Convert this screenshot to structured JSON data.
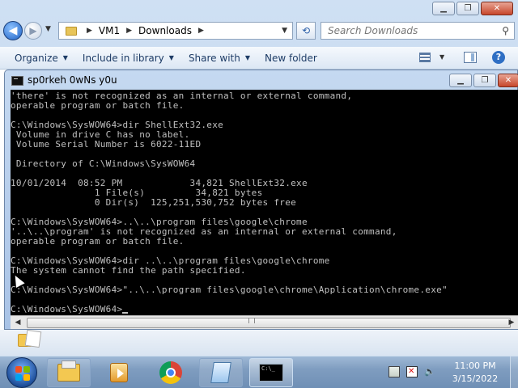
{
  "explorer": {
    "address_segments": [
      "VM1",
      "Downloads"
    ],
    "search_placeholder": "Search Downloads",
    "commands": [
      {
        "label": "Organize"
      },
      {
        "label": "Include in library"
      },
      {
        "label": "Share with"
      },
      {
        "label": "New folder"
      }
    ]
  },
  "cmd_window": {
    "title": "sp0rkeh 0wNs y0u",
    "lines": [
      "'there' is not recognized as an internal or external command,",
      "operable program or batch file.",
      "",
      "C:\\Windows\\SysWOW64>dir ShellExt32.exe",
      " Volume in drive C has no label.",
      " Volume Serial Number is 6022-11ED",
      "",
      " Directory of C:\\Windows\\SysWOW64",
      "",
      "10/01/2014  08:52 PM            34,821 ShellExt32.exe",
      "               1 File(s)         34,821 bytes",
      "               0 Dir(s)  125,251,530,752 bytes free",
      "",
      "C:\\Windows\\SysWOW64>..\\..\\program files\\google\\chrome",
      "'..\\..\\program' is not recognized as an internal or external command,",
      "operable program or batch file.",
      "",
      "C:\\Windows\\SysWOW64>dir ..\\..\\program files\\google\\chrome",
      "The system cannot find the path specified.",
      "",
      "C:\\Windows\\SysWOW64>\"..\\..\\program files\\google\\chrome\\Application\\chrome.exe\"",
      "",
      "C:\\Windows\\SysWOW64>"
    ]
  },
  "taskbar": {
    "time": "11:00 PM",
    "date": "3/15/2022",
    "cmd_icon_text": "C:\\_"
  }
}
